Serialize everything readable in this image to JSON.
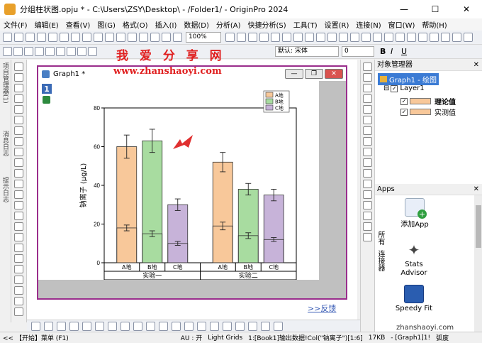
{
  "window": {
    "title": "分组柱状图.opju * - C:\\Users\\ZSY\\Desktop\\ - /Folder1/ - OriginPro 2024",
    "minimize": "—",
    "maximize": "☐",
    "close": "✕"
  },
  "menu": [
    "文件(F)",
    "编辑(E)",
    "查看(V)",
    "图(G)",
    "格式(O)",
    "插入(I)",
    "数据(D)",
    "分析(A)",
    "快捷分析(S)",
    "工具(T)",
    "设置(R)",
    "连接(N)",
    "窗口(W)",
    "帮助(H)"
  ],
  "toolbar": {
    "zoom": "100%",
    "font": "默认: 宋体",
    "font_size": "0",
    "bold": "B",
    "italic": "I",
    "underline": "U"
  },
  "watermark": {
    "cn": "我 爱 分 享 网",
    "url": "www.zhanshaoyi.com"
  },
  "left_tabs": [
    "项目管理器(1)",
    "消息日志",
    "提示日志"
  ],
  "graph_window": {
    "title": "Graph1 *",
    "layer_badge": "1",
    "feedback_link": ">>反馈"
  },
  "chart_data": {
    "type": "bar",
    "ylabel": "钠离子 (μg/L)",
    "ylim": [
      0,
      80
    ],
    "yticks": [
      0,
      20,
      40,
      60,
      80
    ],
    "groups": [
      "实验一",
      "实验二"
    ],
    "categories": [
      "A地",
      "B地",
      "C地"
    ],
    "legend": [
      "A地",
      "B地",
      "C地"
    ],
    "legend_position": "top-right",
    "colors": [
      "#f8c89a",
      "#a8dca0",
      "#c7b3d9"
    ],
    "series": [
      {
        "name": "理论值",
        "values": [
          [
            60,
            63,
            30
          ],
          [
            52,
            38,
            35
          ]
        ],
        "errors": [
          [
            6,
            6,
            3
          ],
          [
            5,
            3,
            3
          ]
        ]
      },
      {
        "name": "实测值",
        "values": [
          [
            18,
            15,
            10
          ],
          [
            19,
            14,
            12
          ]
        ],
        "errors": [
          [
            1.5,
            1.5,
            1
          ],
          [
            2,
            1.5,
            1
          ]
        ]
      }
    ]
  },
  "object_manager": {
    "title": "对象管理器",
    "graph": "Graph1 - 绘图",
    "layer": "Layer1",
    "plots": [
      "理论值",
      "实测值"
    ]
  },
  "apps": {
    "title": "Apps",
    "items": [
      "添加App",
      "Stats Advisor",
      "Speedy Fit"
    ],
    "side_tabs": [
      "所有",
      "连接器"
    ],
    "watermark": "zhanshaoyi.com"
  },
  "statusbar": {
    "start": "<< 【开始】菜单 (F1)",
    "au": "AU : 开",
    "grids": "Light Grids",
    "info": "1:[Book1]输出数据!Col(\"钠离子\")[1:6]",
    "size": "17KB",
    "graph": "- [Graph1]1!",
    "unit": "弧度"
  },
  "colors": {
    "graph_frame": "#9a2d8c",
    "watermark": "#e02020",
    "link": "#3a5db6"
  }
}
